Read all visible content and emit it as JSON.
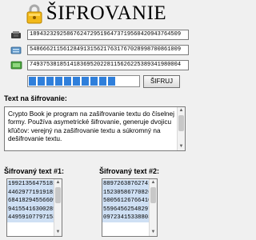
{
  "header": {
    "title": "ŠIFROVANIE",
    "lock_icon": "lock-icon"
  },
  "keys": [
    {
      "icon": "usb-key-icon",
      "value": "189432329258676247295196473719560420943764509"
    },
    {
      "icon": "database-key-icon",
      "value": "548666211561284913156217631767028998700861009"
    },
    {
      "icon": "battery-key-icon",
      "value": "749375381851418369520228115626225389341980004"
    }
  ],
  "progress": {
    "percent": 77
  },
  "encrypt_button": "ŠIFRUJ",
  "plaintext": {
    "label": "Text na šifrovanie:",
    "value": "Crypto Book je program na zašifrovanie textu do číselnej formy. Používa asymetrické šifrovanie, generuje dvojicu kľúčov: verejný na zašifrovanie textu a súkromný na dešifrovanie textu."
  },
  "cipher1": {
    "label": "Šifrovaný text #1:",
    "lines": [
      "1992135647518115244",
      "4462977191918196",
      "6841829455660927",
      "9415541630028515",
      "4495910779715315"
    ]
  },
  "cipher2": {
    "label": "Šifrovaný text #2:",
    "lines": [
      "8897263876274112744",
      "1523058677082621",
      "5005612676641049",
      "5596456254829732",
      "0972341533880361"
    ]
  },
  "colors": {
    "progress": "#2f7fdb",
    "selection": "#cfe0f4",
    "background": "#f0f0f0"
  }
}
